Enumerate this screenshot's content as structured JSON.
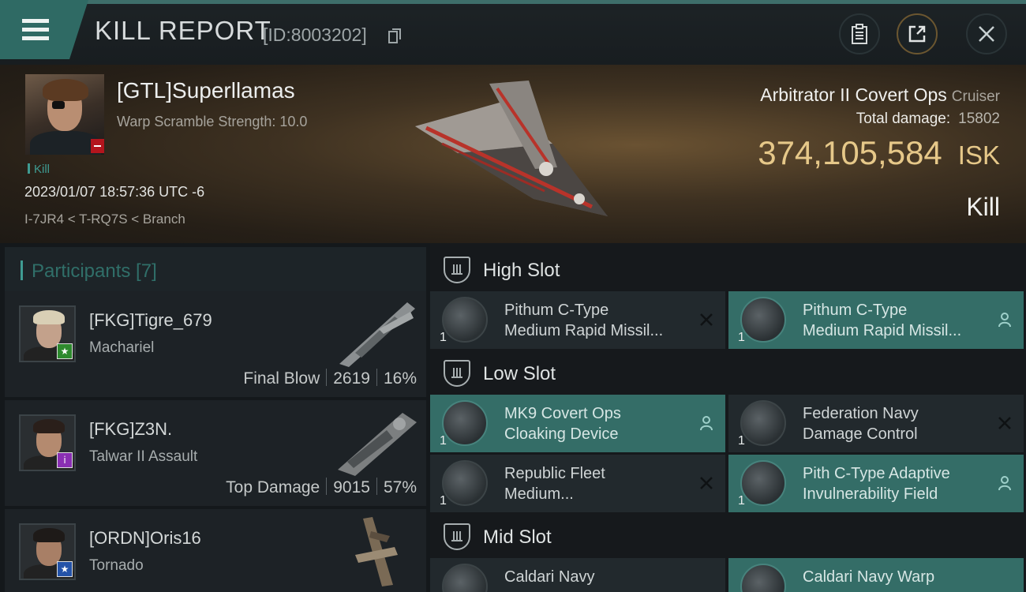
{
  "header": {
    "title": "KILL REPORT",
    "id_label": "[ID:8003202]"
  },
  "victim": {
    "name": "[GTL]Superllamas",
    "subtitle": "Warp Scramble Strength: 10.0",
    "tag": "Kill",
    "datetime": "2023/01/07 18:57:36 UTC -6",
    "location": "I-7JR4 < T-RQ7S < Branch"
  },
  "ship": {
    "name": "Arbitrator II Covert Ops",
    "class": "Cruiser",
    "damage_label": "Total damage:",
    "damage_value": "15802",
    "isk_value": "374,105,584",
    "isk_unit": "ISK",
    "result": "Kill"
  },
  "participants": {
    "title": "Participants [7]",
    "rows": [
      {
        "name": "[FKG]Tigre_679",
        "ship": "Machariel",
        "label": "Final Blow",
        "damage": "2619",
        "percent": "16%",
        "badge": "★",
        "badge_color": "#2e8a2e",
        "hair": "#d9cfb5"
      },
      {
        "name": "[FKG]Z3N.",
        "ship": "Talwar II Assault",
        "label": "Top Damage",
        "damage": "9015",
        "percent": "57%",
        "badge": "i",
        "badge_color": "#8a2fb3",
        "hair": "#2a1f1a"
      },
      {
        "name": "[ORDN]Oris16",
        "ship": "Tornado",
        "label": "",
        "damage": "",
        "percent": "",
        "badge": "★",
        "badge_color": "#2453a8",
        "hair": "#1e1a18"
      }
    ]
  },
  "fitting": {
    "high_slot": {
      "title": "High Slot",
      "modules": [
        {
          "name": "Pithum C-Type\nMedium Rapid Missil...",
          "qty": "1",
          "action": "close-icon"
        },
        {
          "name": "Pithum C-Type\nMedium Rapid Missil...",
          "qty": "1",
          "action": "pilot-icon"
        }
      ]
    },
    "low_slot": {
      "title": "Low Slot",
      "modules": [
        {
          "name": "MK9 Covert Ops\nCloaking Device",
          "qty": "1",
          "action": "pilot-icon"
        },
        {
          "name": "Federation Navy\nDamage Control",
          "qty": "1",
          "action": "close-icon"
        },
        {
          "name": "Republic Fleet\nMedium...",
          "qty": "1",
          "action": "close-icon"
        },
        {
          "name": "Pith C-Type Adaptive\nInvulnerability Field",
          "qty": "1",
          "action": "pilot-icon"
        }
      ]
    },
    "mid_slot": {
      "title": "Mid Slot",
      "modules": [
        {
          "name": "Caldari Navy",
          "qty": "",
          "action": "close-icon"
        },
        {
          "name": "Caldari Navy Warp",
          "qty": "",
          "action": "pilot-icon"
        }
      ]
    }
  },
  "colors": {
    "accent": "#3f9b92",
    "highlight_row": "#346d67",
    "isk": "#e6c889",
    "victim_badge": "#b3151d"
  }
}
